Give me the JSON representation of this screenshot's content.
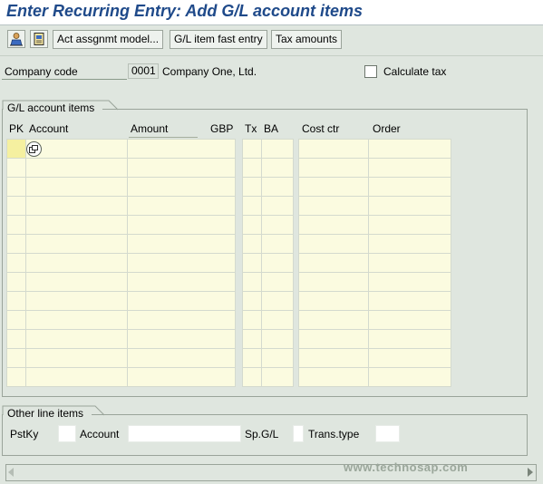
{
  "title": "Enter Recurring Entry: Add G/L account items",
  "toolbar": {
    "icons": [
      "person-icon",
      "document-icon"
    ],
    "buttons": [
      "Act assgnmt model...",
      "G/L item fast entry",
      "Tax amounts"
    ]
  },
  "header": {
    "company_code_label": "Company code",
    "company_code_value": "0001",
    "company_name": "Company One, Ltd.",
    "calculate_tax_label": "Calculate tax",
    "calculate_tax_checked": false
  },
  "gl_items": {
    "group_title": "G/L account items",
    "columns": {
      "pk": "PK",
      "account": "Account",
      "amount": "Amount",
      "currency": "GBP",
      "tx": "Tx",
      "ba": "BA",
      "cost_ctr": "Cost ctr",
      "order": "Order"
    }
  },
  "other_line": {
    "group_title": "Other line items",
    "pstky_label": "PstKy",
    "account_label": "Account",
    "spgl_label": "Sp.G/L",
    "transtype_label": "Trans.type"
  },
  "watermark": "www.technosap.com",
  "colors": {
    "title": "#1f4a8a",
    "background": "#dfe6df",
    "grid_cell": "#fbfbe0"
  }
}
